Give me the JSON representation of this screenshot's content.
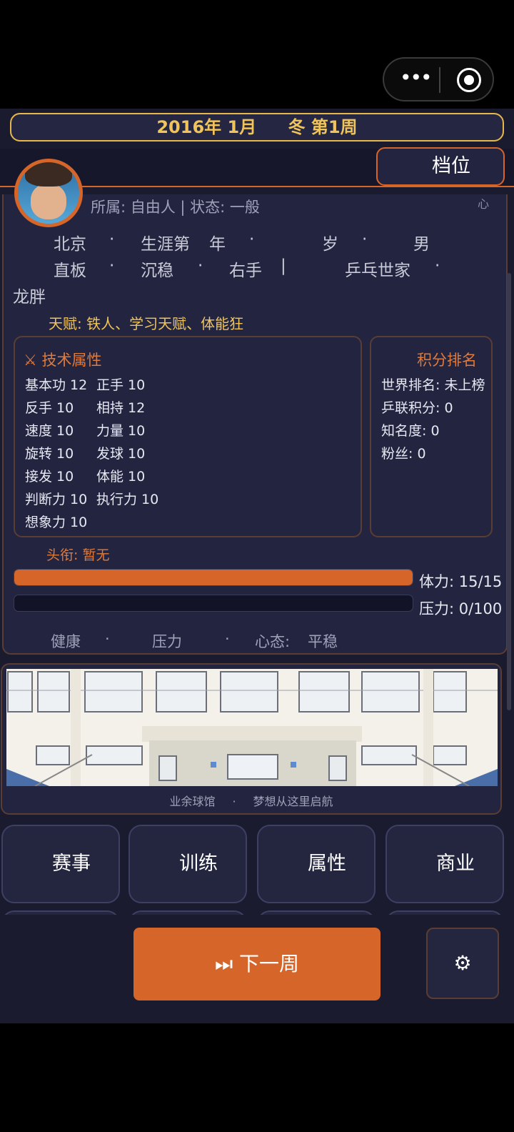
{
  "capsule": {
    "more_icon": "more-dots-icon",
    "close_icon": "target-icon",
    "dots": "•••"
  },
  "date_bar": {
    "date": "2016年 1月",
    "season_week": "冬 第1周"
  },
  "tier_button": {
    "label": "档位"
  },
  "profile": {
    "corner_char": "心",
    "affiliation": "所属: 自由人 | 状态: 一般",
    "row1": [
      "北京",
      "·",
      "生涯第",
      "年",
      "·",
      "岁",
      "·",
      "男"
    ],
    "row2": [
      "直板",
      "·",
      "沉稳",
      "·",
      "右手",
      "|",
      "乒乓世家",
      "·"
    ],
    "row3": "龙胖",
    "talent": "天赋: 铁人、学习天赋、体能狂"
  },
  "tech": {
    "title": "⚔ 技术属性",
    "left": [
      "基本功 12",
      "反手 10",
      "速度 10",
      "旋转 10",
      "接发 10",
      "判断力 10",
      "想象力 10"
    ],
    "right": [
      "正手 10",
      "相持 12",
      "力量 10",
      "发球 10",
      "体能 10",
      "执行力 10"
    ]
  },
  "ranking": {
    "title": "积分排名",
    "items": [
      "世界排名: 未上榜",
      "乒联积分: 0",
      "知名度: 0",
      "粉丝: 0"
    ]
  },
  "title_line": "头衔: 暂无",
  "stamina": {
    "label": "体力: 15/15",
    "fraction": 1.0
  },
  "pressure": {
    "label": "压力: 0/100",
    "fraction": 0.0
  },
  "status_row": [
    "健康",
    "·",
    "压力",
    "·",
    "心态:",
    "平稳"
  ],
  "scene": {
    "place": "业余球馆",
    "sep": "·",
    "motto": "梦想从这里启航"
  },
  "actions": [
    "赛事",
    "训练",
    "属性",
    "商业"
  ],
  "next_week": {
    "label": "⏭ 下一周"
  },
  "settings": {
    "icon": "gear-icon",
    "glyph": "⚙"
  },
  "colors": {
    "accent": "#d6652a",
    "gold": "#f0c45a",
    "panel": "#232540"
  }
}
